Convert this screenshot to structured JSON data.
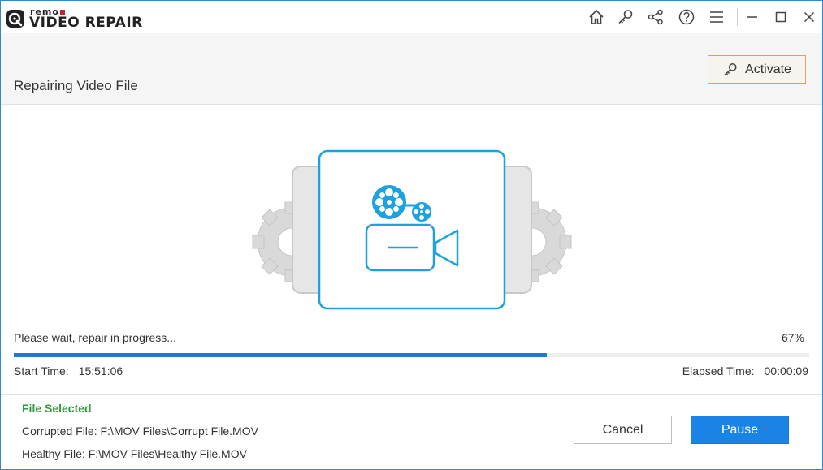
{
  "app": {
    "logo_small": "remo",
    "logo_big": "VIDEO REPAIR"
  },
  "titlebar": {
    "icons": [
      "home-icon",
      "key-icon",
      "share-icon",
      "help-icon",
      "menu-icon",
      "minimize-icon",
      "maximize-icon",
      "close-icon"
    ]
  },
  "header": {
    "title": "Repairing Video File",
    "activate_label": "Activate"
  },
  "progress": {
    "status": "Please wait, repair in progress...",
    "percent_label": "67%",
    "percent": 67,
    "start_label": "Start Time:",
    "start_value": "15:51:06",
    "elapsed_label": "Elapsed Time:",
    "elapsed_value": "00:00:09"
  },
  "files": {
    "heading": "File Selected",
    "corrupted": "Corrupted File: F:\\MOV Files\\Corrupt File.MOV",
    "healthy": "Healthy File: F:\\MOV Files\\Healthy File.MOV"
  },
  "buttons": {
    "cancel": "Cancel",
    "pause": "Pause"
  },
  "colors": {
    "accent": "#1a84e6",
    "progress": "#1a7ad9",
    "illustration": "#1ca3dd",
    "file_selected": "#2f9a3a",
    "activate_border": "#d9a15b"
  }
}
